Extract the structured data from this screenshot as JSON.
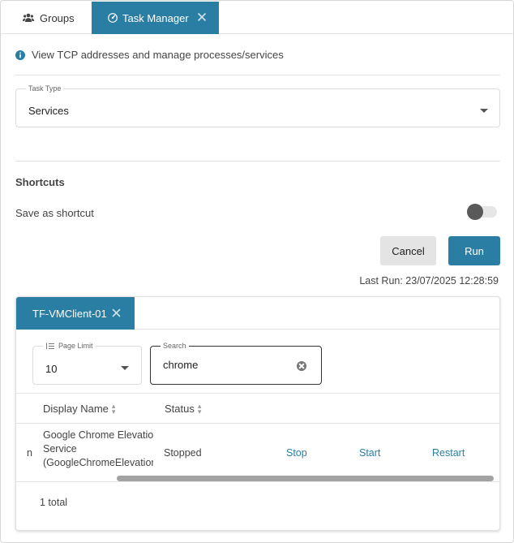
{
  "tabs": {
    "groups_label": "Groups",
    "task_manager_label": "Task Manager"
  },
  "info_text": "View TCP addresses and manage processes/services",
  "task_type": {
    "label": "Task Type",
    "value": "Services"
  },
  "shortcuts": {
    "title": "Shortcuts",
    "save_label": "Save as shortcut",
    "save_enabled": false
  },
  "buttons": {
    "cancel": "Cancel",
    "run": "Run"
  },
  "last_run": "Last Run: 23/07/2025 12:28:59",
  "results": {
    "tab_label": "TF-VMClient-01",
    "page_limit": {
      "label": "Page Limit",
      "value": "10"
    },
    "search": {
      "label": "Search",
      "value": "chrome"
    },
    "columns": {
      "display_name": "Display Name",
      "status": "Status"
    },
    "rows": [
      {
        "cut_prefix": "n",
        "display_name_lines": [
          "Google Chrome Elevatio",
          "Service",
          "(GoogleChromeElevation"
        ],
        "status": "Stopped",
        "actions": [
          "Stop",
          "Start",
          "Restart"
        ]
      }
    ],
    "total": "1 total"
  },
  "colors": {
    "accent": "#2b7ea3",
    "toggle_knob": "#595959"
  }
}
